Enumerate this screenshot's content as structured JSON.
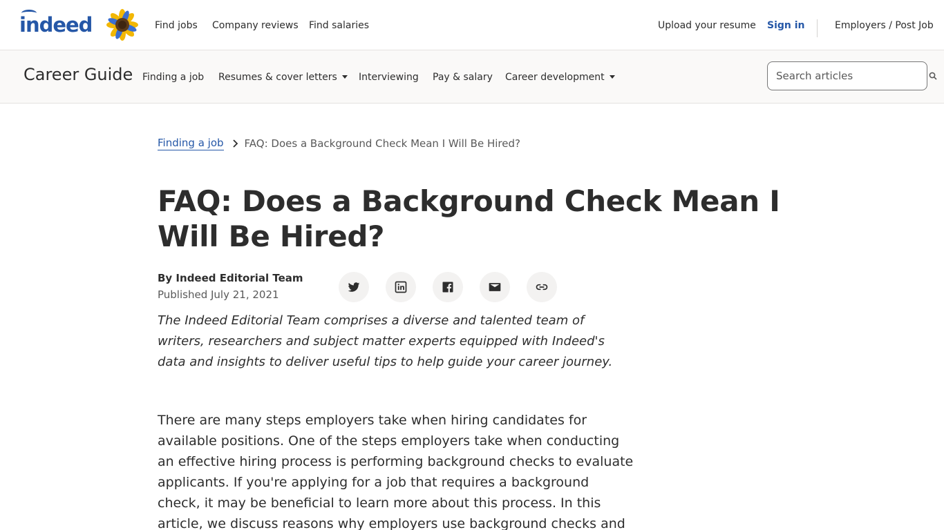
{
  "header": {
    "logo_text": "indeed",
    "nav": {
      "find_jobs": "Find jobs",
      "company_reviews": "Company reviews",
      "find_salaries": "Find salaries",
      "upload_resume": "Upload your resume",
      "sign_in": "Sign in",
      "employers": "Employers / Post Job"
    }
  },
  "guide": {
    "title": "Career Guide",
    "nav": {
      "finding_a_job": "Finding a job",
      "resumes": "Resumes & cover letters",
      "interviewing": "Interviewing",
      "pay_salary": "Pay & salary",
      "career_development": "Career development"
    },
    "search_placeholder": "Search articles"
  },
  "breadcrumb": {
    "parent": "Finding a job",
    "current": "FAQ: Does a Background Check Mean I Will Be Hired?"
  },
  "article": {
    "title": "FAQ: Does a Background Check Mean I Will Be Hired?",
    "author": "By Indeed Editorial Team",
    "published": "Published July 21, 2021",
    "bio": "The Indeed Editorial Team comprises a diverse and talented team of writers, researchers and subject matter experts equipped with Indeed's data and insights to deliver useful tips to help guide your career journey.",
    "intro": "There are many steps employers take when hiring candidates for available positions. One of the steps employers take when conducting an effective hiring process is performing background checks to evaluate applicants. If you're applying for a job that requires a background check, it may be beneficial to learn more about this process. In this article, we discuss reasons why employers use background checks and the ways in"
  },
  "share_icons": [
    "twitter-icon",
    "linkedin-icon",
    "facebook-icon",
    "email-icon",
    "link-icon"
  ],
  "colors": {
    "brand_blue": "#2557a7",
    "text": "#2d2d2d",
    "muted": "#595959",
    "guide_bg": "#faf9f8",
    "share_bg": "#f3f2f1"
  }
}
